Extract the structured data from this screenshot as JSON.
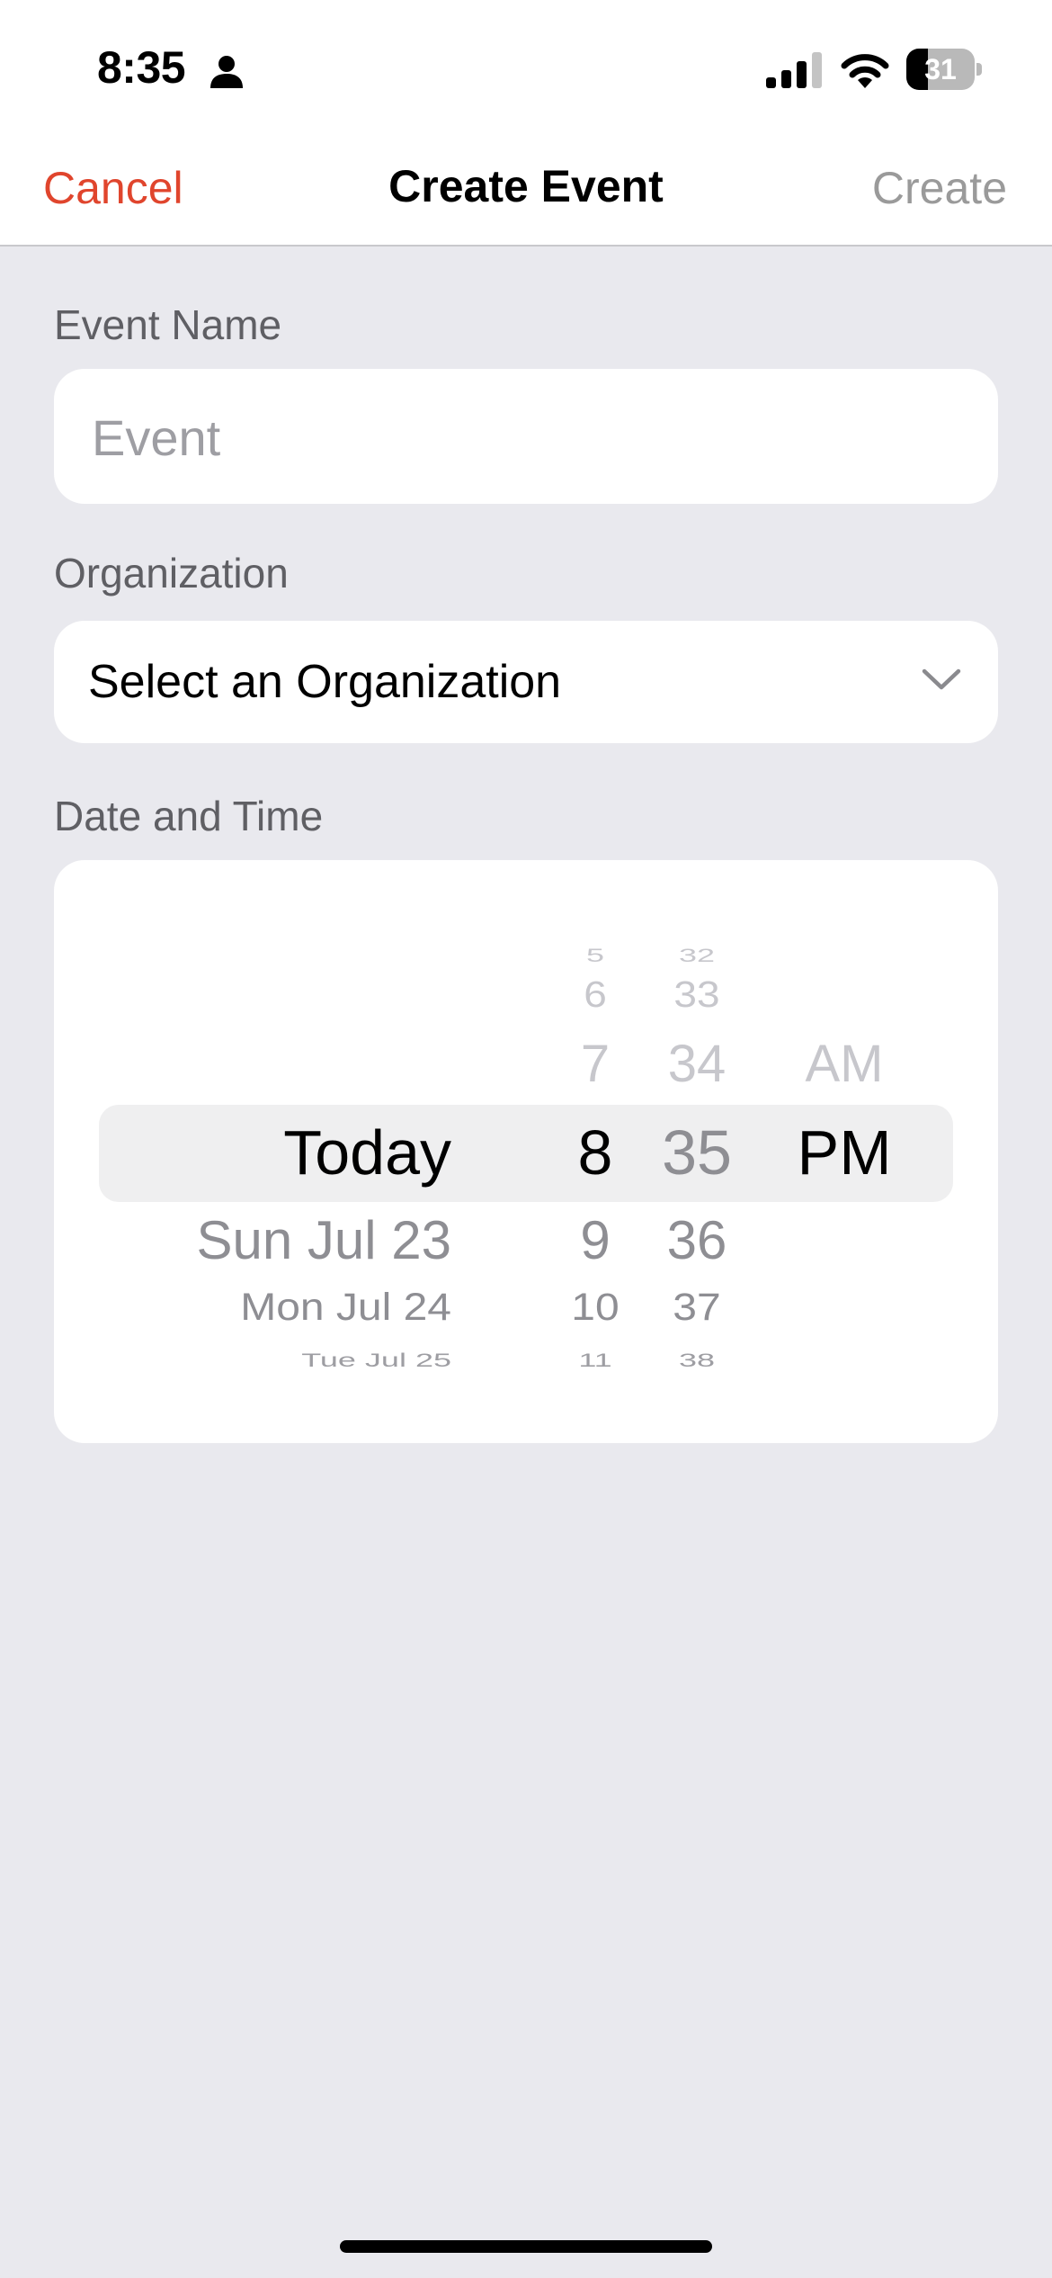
{
  "status_bar": {
    "time": "8:35",
    "battery": "31",
    "battery_level": 0.31
  },
  "nav": {
    "cancel_label": "Cancel",
    "title": "Create Event",
    "create_label": "Create"
  },
  "form": {
    "event_name": {
      "label": "Event Name",
      "placeholder": "Event",
      "value": ""
    },
    "organization": {
      "label": "Organization",
      "selected": "Select an Organization"
    },
    "date_time": {
      "label": "Date and Time",
      "picker": {
        "dates": [
          "Sun Jul 23",
          "Mon Jul 24",
          "Tue Jul 25"
        ],
        "selected_date": "Today",
        "hours": [
          "5",
          "6",
          "7",
          "8",
          "9",
          "10",
          "11"
        ],
        "selected_hour": "8",
        "minutes": [
          "32",
          "33",
          "34",
          "35",
          "36",
          "37",
          "38"
        ],
        "selected_minute": "35",
        "periods": [
          "AM",
          "PM"
        ],
        "selected_period": "PM"
      }
    }
  }
}
